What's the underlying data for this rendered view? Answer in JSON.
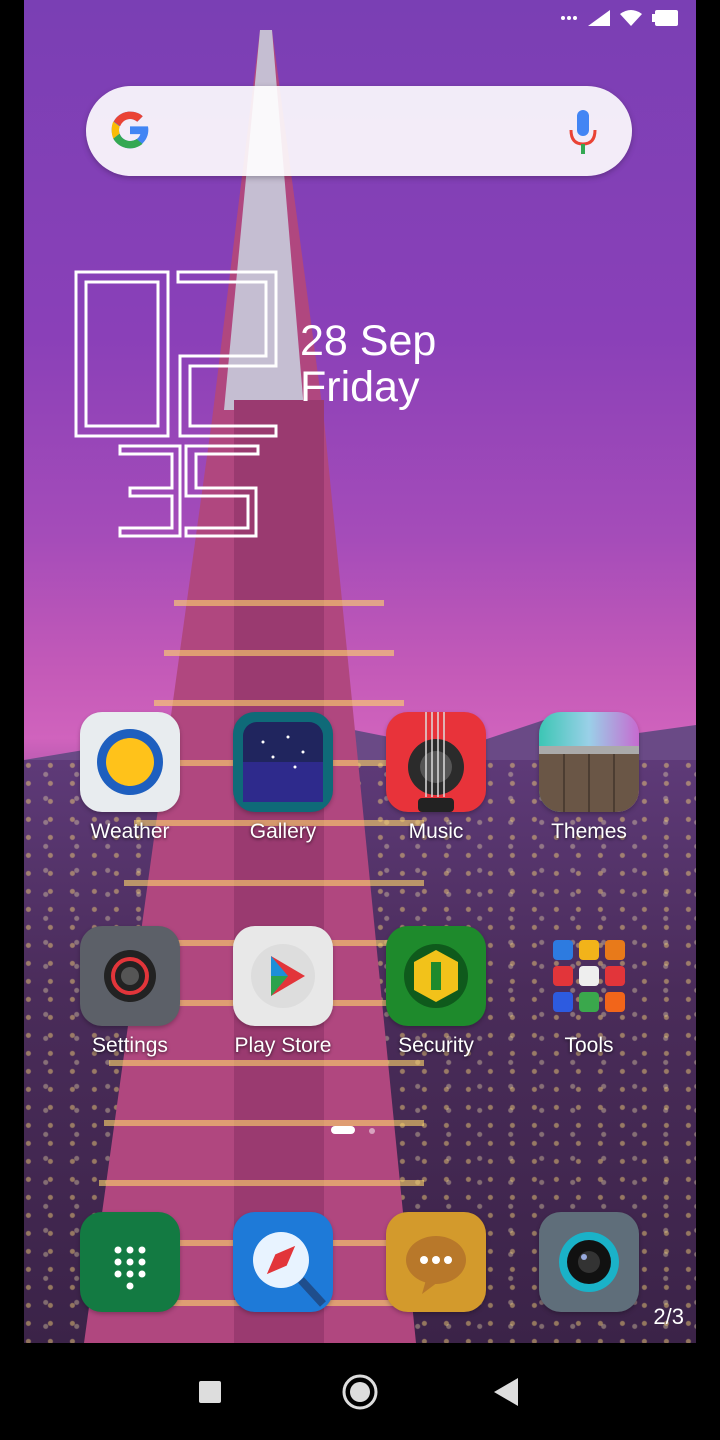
{
  "status_bar": {
    "icons": [
      "more-dots-icon",
      "signal-icon",
      "wifi-icon",
      "battery-icon"
    ]
  },
  "search": {
    "icons": [
      "google-logo",
      "mic-icon"
    ]
  },
  "clock": {
    "hours": "02",
    "minutes": "35",
    "date": "28 Sep",
    "day": "Friday"
  },
  "apps": [
    {
      "label": "Weather",
      "icon": "weather-icon"
    },
    {
      "label": "Gallery",
      "icon": "gallery-icon"
    },
    {
      "label": "Music",
      "icon": "music-icon"
    },
    {
      "label": "Themes",
      "icon": "themes-icon"
    },
    {
      "label": "Settings",
      "icon": "settings-icon"
    },
    {
      "label": "Play Store",
      "icon": "play-store-icon"
    },
    {
      "label": "Security",
      "icon": "security-icon"
    },
    {
      "label": "Tools",
      "icon": "tools-folder-icon"
    }
  ],
  "dock": [
    {
      "icon": "phone-dialer-icon"
    },
    {
      "icon": "browser-compass-icon"
    },
    {
      "icon": "messages-icon"
    },
    {
      "icon": "camera-icon"
    }
  ],
  "page_indicator": "2/3",
  "navbar": {
    "icons": [
      "recents-square-icon",
      "home-circle-icon",
      "back-triangle-icon"
    ]
  },
  "colors": {
    "search_bg": "#ffffff",
    "sky_top": "#7a3fb4",
    "sky_glow": "#d063bd"
  }
}
